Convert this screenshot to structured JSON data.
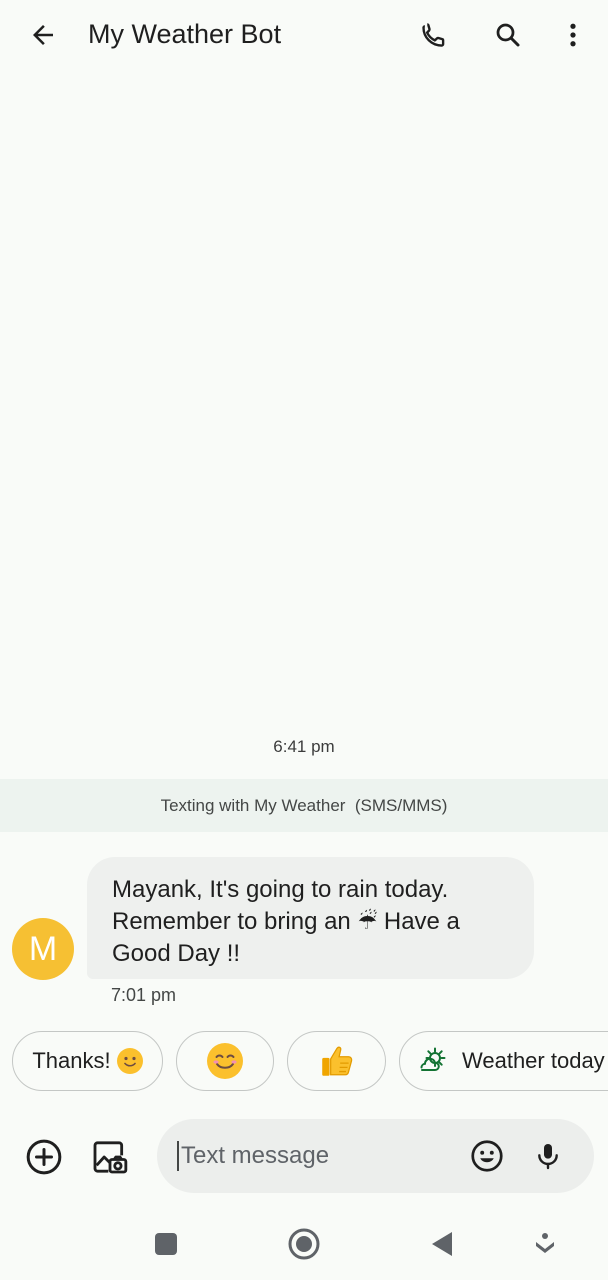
{
  "header": {
    "title": "My Weather Bot",
    "back_icon": "arrow-back-icon",
    "call_icon": "phone-icon",
    "search_icon": "search-icon",
    "more_icon": "more-vert-icon"
  },
  "conversation": {
    "timestamp_header": "6:41 pm",
    "banner_text": "Texting with My Weather  (SMS/MMS)",
    "avatar_initial": "M",
    "avatar_color": "#f6c033",
    "message": {
      "line1": "Mayank, It's going to rain today.",
      "line2_before": "Remember to bring an",
      "line2_emoji": "☔",
      "line2_after": "Have a",
      "line3": "Good Day !!",
      "time": "7:01 pm"
    }
  },
  "smart_replies": [
    {
      "label": "Thanks!",
      "emoji": "slightly-smiling-face"
    },
    {
      "label": "",
      "emoji": "smiling-face-with-smiling-eyes"
    },
    {
      "label": "",
      "emoji": "thumbs-up"
    },
    {
      "label": "Weather today",
      "icon": "partly-cloudy-icon"
    }
  ],
  "composer": {
    "placeholder": "Text message",
    "add_icon": "add-circle-icon",
    "media_icon": "gallery-camera-icon",
    "emoji_icon": "emoji-icon",
    "mic_icon": "mic-icon"
  },
  "navigation": {
    "recent_icon": "recent-apps-icon",
    "home_icon": "home-icon",
    "back_icon": "back-triangle-icon",
    "assist_icon": "assistant-icon"
  }
}
